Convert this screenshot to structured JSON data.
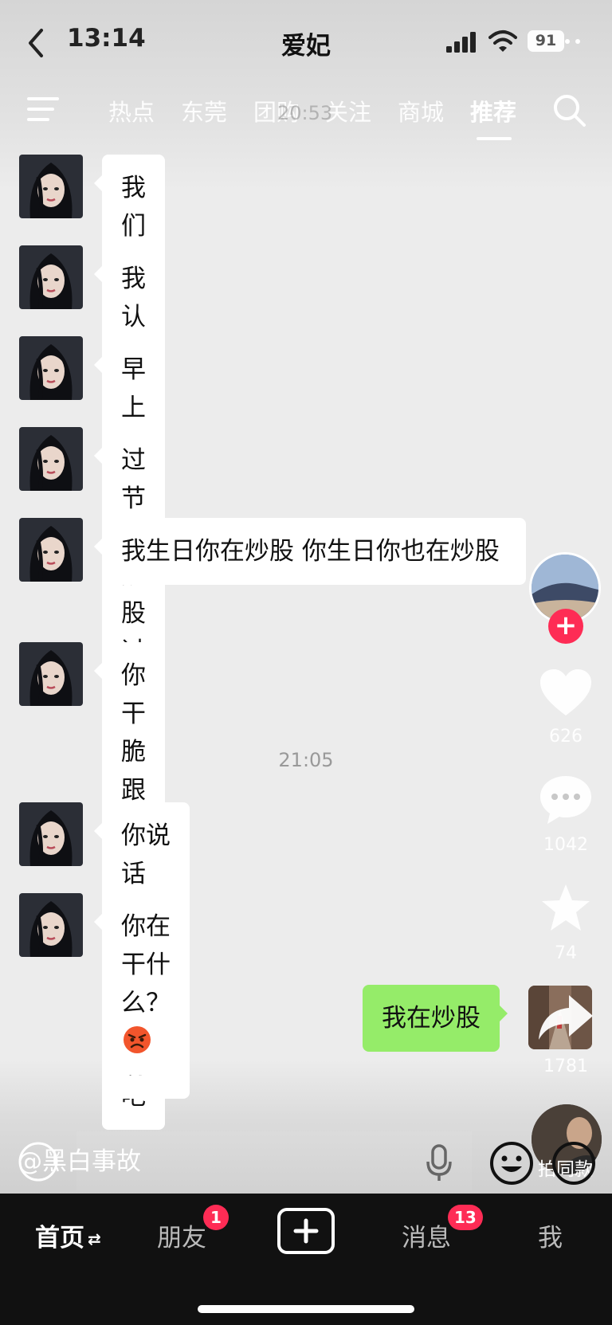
{
  "status_bar": {
    "time": "13:14",
    "contact": "爱妃",
    "battery": "91"
  },
  "top_nav": {
    "tabs": [
      "热点",
      "东莞",
      "团购",
      "关注",
      "商城",
      "推荐"
    ],
    "active_tab": "推荐",
    "overlay_time": "20:53"
  },
  "chat": {
    "messages": [
      {
        "from": "her",
        "text": "我们分手吧"
      },
      {
        "from": "her",
        "text": "我认识你那年你在炒股"
      },
      {
        "from": "her",
        "text": "早上在炒股 下午在炒股"
      },
      {
        "from": "her",
        "text": "过节在炒股 过年也在炒股"
      },
      {
        "from": "her",
        "text": "我生日你在炒股 你生日你也在炒股"
      },
      {
        "from": "her",
        "text": "你干脆跟你的股票过日子吧"
      },
      {
        "from": "her",
        "text": "你说话啊！ 干嘛不说话啊！"
      },
      {
        "from": "her",
        "text": "你在干什么？",
        "emoji": "angry-face"
      },
      {
        "from": "me",
        "text": "我在炒股"
      }
    ],
    "timestamp_2": "21:05"
  },
  "rail": {
    "likes": "626",
    "comments": "1042",
    "favorites": "74",
    "shares": "1781",
    "music_label": "拍同款"
  },
  "caption": "@黑白事故",
  "tab_bar": {
    "home": "首页",
    "home_switch": "⇄",
    "friends": "朋友",
    "friends_badge": "1",
    "messages": "消息",
    "messages_badge": "13",
    "me": "我"
  },
  "colors": {
    "accent": "#fe2c55",
    "my_bubble": "#95ec69",
    "their_bubble": "#ffffff",
    "chat_bg": "#ececec"
  }
}
